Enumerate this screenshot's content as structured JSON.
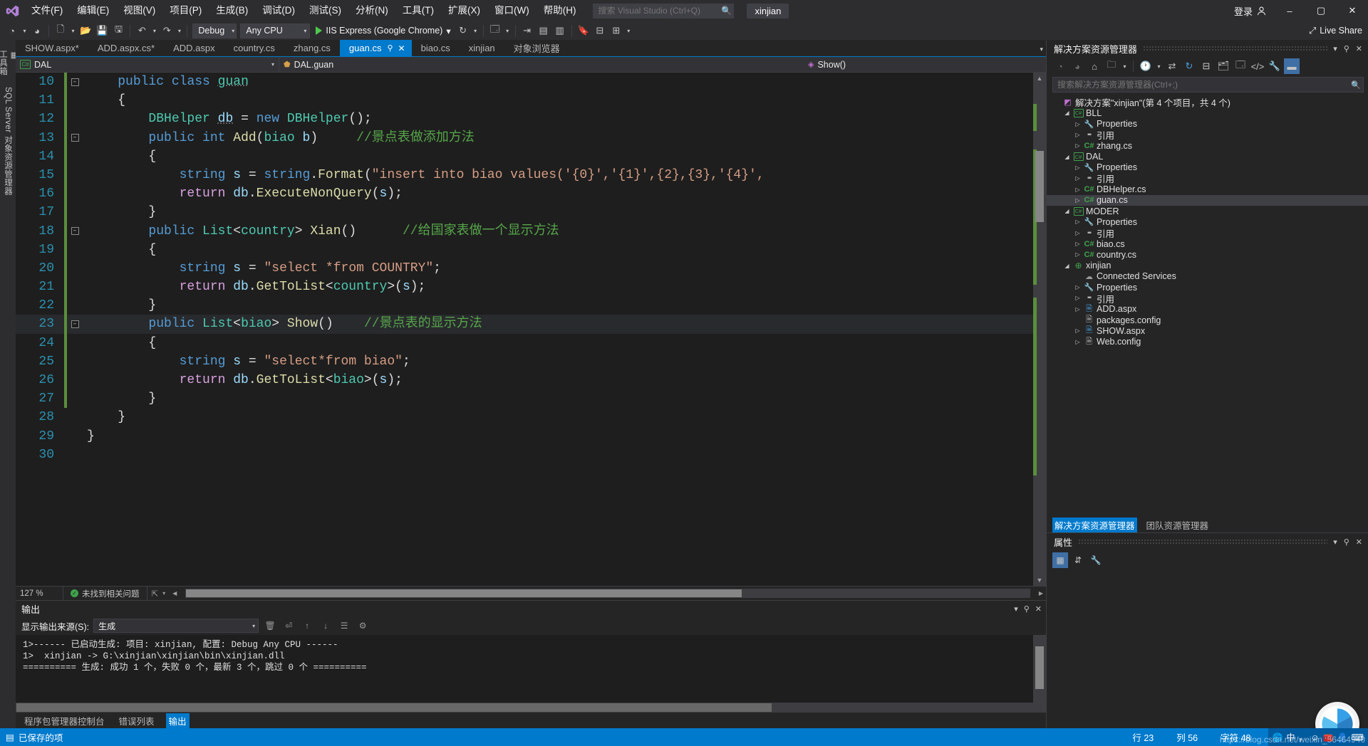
{
  "window": {
    "title": "xinjian",
    "signin_label": "登录",
    "minimize": "–",
    "maximize": "▢",
    "close": "✕"
  },
  "menu": {
    "items": [
      {
        "label": "文件(F)",
        "name": "menu-file"
      },
      {
        "label": "编辑(E)",
        "name": "menu-edit"
      },
      {
        "label": "视图(V)",
        "name": "menu-view"
      },
      {
        "label": "项目(P)",
        "name": "menu-project"
      },
      {
        "label": "生成(B)",
        "name": "menu-build"
      },
      {
        "label": "调试(D)",
        "name": "menu-debug"
      },
      {
        "label": "测试(S)",
        "name": "menu-test"
      },
      {
        "label": "分析(N)",
        "name": "menu-analyze"
      },
      {
        "label": "工具(T)",
        "name": "menu-tools"
      },
      {
        "label": "扩展(X)",
        "name": "menu-extensions"
      },
      {
        "label": "窗口(W)",
        "name": "menu-window"
      },
      {
        "label": "帮助(H)",
        "name": "menu-help"
      }
    ]
  },
  "quick_search": {
    "placeholder": "搜索 Visual Studio (Ctrl+Q)",
    "value": ""
  },
  "toolbar": {
    "config_value": "Debug",
    "platform_value": "Any CPU",
    "run_label": "IIS Express (Google Chrome)",
    "live_share": "Live Share"
  },
  "editor_tabs": [
    {
      "label": "SHOW.aspx*",
      "active": false
    },
    {
      "label": "ADD.aspx.cs*",
      "active": false
    },
    {
      "label": "ADD.aspx",
      "active": false
    },
    {
      "label": "country.cs",
      "active": false
    },
    {
      "label": "zhang.cs",
      "active": false
    },
    {
      "label": "guan.cs",
      "active": true
    },
    {
      "label": "biao.cs",
      "active": false
    },
    {
      "label": "xinjian",
      "active": false
    },
    {
      "label": "对象浏览器",
      "active": false
    }
  ],
  "nav_bar": {
    "namespace": "DAL",
    "type": "DAL.guan",
    "member": "Show()"
  },
  "left_rail": [
    {
      "label": "工具箱",
      "name": "toolbox"
    },
    {
      "label": "SQL Server 对象资源管理器",
      "name": "sql-server-object-explorer"
    }
  ],
  "code": {
    "zoom": "127 %",
    "issues": "未找到相关问题",
    "lines": [
      {
        "n": "10",
        "fold": "minus",
        "change": true,
        "html": "<span class=\"kw\">public</span> <span class=\"kw\">class</span> <span class=\"typ udl\">guan</span>",
        "indent": 2
      },
      {
        "n": "11",
        "fold": "",
        "change": true,
        "html": "<span class=\"brc\">{</span>",
        "indent": 2
      },
      {
        "n": "12",
        "fold": "",
        "change": true,
        "html": "<span class=\"typ\">DBHelper</span> <span class=\"var udl\">db</span> <span class=\"pun\">=</span> <span class=\"kw\">new</span> <span class=\"typ\">DBHelper</span><span class=\"pun\">();</span>",
        "indent": 3
      },
      {
        "n": "13",
        "fold": "minus",
        "change": true,
        "html": "<span class=\"kw\">public</span> <span class=\"kw\">int</span> <span class=\"mth\">Add</span><span class=\"pun\">(</span><span class=\"typ\">biao</span> <span class=\"var\">b</span><span class=\"pun\">)</span>     <span class=\"cmt\">//景点表做添加方法</span>",
        "indent": 3
      },
      {
        "n": "14",
        "fold": "",
        "change": true,
        "html": "<span class=\"brc\">{</span>",
        "indent": 3
      },
      {
        "n": "15",
        "fold": "",
        "change": true,
        "html": "<span class=\"kw\">string</span> <span class=\"var\">s</span> <span class=\"pun\">=</span> <span class=\"kw\">string</span><span class=\"pun\">.</span><span class=\"mth\">Format</span><span class=\"pun\">(</span><span class=\"str\">\"insert into biao values('{0}','{1}',{2},{3},'{4}',</span>",
        "indent": 4
      },
      {
        "n": "16",
        "fold": "",
        "change": true,
        "html": "<span class=\"ctl\">return</span> <span class=\"var\">db</span><span class=\"pun\">.</span><span class=\"mth\">ExecuteNonQuery</span><span class=\"pun\">(</span><span class=\"var\">s</span><span class=\"pun\">);</span>",
        "indent": 4
      },
      {
        "n": "17",
        "fold": "",
        "change": true,
        "html": "<span class=\"brc\">}</span>",
        "indent": 3
      },
      {
        "n": "18",
        "fold": "minus",
        "change": true,
        "html": "<span class=\"kw\">public</span> <span class=\"typ\">List</span><span class=\"pun\">&lt;</span><span class=\"typ\">country</span><span class=\"pun\">&gt;</span> <span class=\"mth\">Xian</span><span class=\"pun\">()</span>      <span class=\"cmt\">//给国家表做一个显示方法</span>",
        "indent": 3
      },
      {
        "n": "19",
        "fold": "",
        "change": true,
        "html": "<span class=\"brc\">{</span>",
        "indent": 3
      },
      {
        "n": "20",
        "fold": "",
        "change": true,
        "html": "<span class=\"kw\">string</span> <span class=\"var\">s</span> <span class=\"pun\">=</span> <span class=\"str\">\"select *from COUNTRY\"</span><span class=\"pun\">;</span>",
        "indent": 4
      },
      {
        "n": "21",
        "fold": "",
        "change": true,
        "html": "<span class=\"ctl\">return</span> <span class=\"var\">db</span><span class=\"pun\">.</span><span class=\"mth\">GetToList</span><span class=\"pun\">&lt;</span><span class=\"typ\">country</span><span class=\"pun\">&gt;(</span><span class=\"var\">s</span><span class=\"pun\">);</span>",
        "indent": 4
      },
      {
        "n": "22",
        "fold": "",
        "change": true,
        "html": "<span class=\"brc\">}</span>",
        "indent": 3
      },
      {
        "n": "23",
        "fold": "minus",
        "change": true,
        "html": "<span class=\"kw\">public</span> <span class=\"typ\">List</span><span class=\"pun\">&lt;</span><span class=\"typ\">biao</span><span class=\"pun\">&gt;</span> <span class=\"mth\">Show</span><span class=\"pun\">()</span>    <span class=\"cmt\">//景点表的显示方法</span>",
        "indent": 3,
        "highlight": true
      },
      {
        "n": "24",
        "fold": "",
        "change": true,
        "html": "<span class=\"brc\">{</span>",
        "indent": 3
      },
      {
        "n": "25",
        "fold": "",
        "change": true,
        "html": "<span class=\"kw\">string</span> <span class=\"var\">s</span> <span class=\"pun\">=</span> <span class=\"str\">\"select*from biao\"</span><span class=\"pun\">;</span>",
        "indent": 4
      },
      {
        "n": "26",
        "fold": "",
        "change": true,
        "html": "<span class=\"ctl\">return</span> <span class=\"var\">db</span><span class=\"pun\">.</span><span class=\"mth\">GetToList</span><span class=\"pun\">&lt;</span><span class=\"typ\">biao</span><span class=\"pun\">&gt;(</span><span class=\"var\">s</span><span class=\"pun\">);</span>",
        "indent": 4
      },
      {
        "n": "27",
        "fold": "",
        "change": true,
        "html": "<span class=\"brc\">}</span>",
        "indent": 3
      },
      {
        "n": "28",
        "fold": "",
        "change": false,
        "html": "<span class=\"brc\">}</span>",
        "indent": 2
      },
      {
        "n": "29",
        "fold": "",
        "change": false,
        "html": "<span class=\"brc\">}</span>",
        "indent": 1
      },
      {
        "n": "30",
        "fold": "",
        "change": false,
        "html": "",
        "indent": 0
      }
    ]
  },
  "output": {
    "title": "输出",
    "source_label": "显示输出来源(S):",
    "source_value": "生成",
    "lines": [
      "1>------ 已启动生成: 项目: xinjian, 配置: Debug Any CPU ------",
      "1>  xinjian -> G:\\xinjian\\xinjian\\bin\\xinjian.dll",
      "========== 生成: 成功 1 个，失败 0 个，最新 3 个，跳过 0 个 =========="
    ],
    "tabs": [
      {
        "label": "程序包管理器控制台",
        "active": false
      },
      {
        "label": "错误列表",
        "active": false
      },
      {
        "label": "输出",
        "active": true
      }
    ]
  },
  "solution_explorer": {
    "title": "解决方案资源管理器",
    "search_placeholder": "搜索解决方案资源管理器(Ctrl+;)",
    "tabs": [
      {
        "label": "解决方案资源管理器",
        "active": true
      },
      {
        "label": "团队资源管理器",
        "active": false
      }
    ],
    "tree": [
      {
        "depth": 0,
        "arrow": "",
        "icon": "sln",
        "label": "解决方案\"xinjian\"(第 4 个项目，共 4 个)",
        "selected": false
      },
      {
        "depth": 1,
        "arrow": "open",
        "icon": "csproj",
        "label": "BLL",
        "selected": false
      },
      {
        "depth": 2,
        "arrow": "closed",
        "icon": "wrench",
        "label": "Properties",
        "selected": false
      },
      {
        "depth": 2,
        "arrow": "closed",
        "icon": "ref",
        "label": "引用",
        "selected": false
      },
      {
        "depth": 2,
        "arrow": "closed",
        "icon": "csfile",
        "label": "zhang.cs",
        "selected": false
      },
      {
        "depth": 1,
        "arrow": "open",
        "icon": "csproj",
        "label": "DAL",
        "selected": false
      },
      {
        "depth": 2,
        "arrow": "closed",
        "icon": "wrench",
        "label": "Properties",
        "selected": false
      },
      {
        "depth": 2,
        "arrow": "closed",
        "icon": "ref",
        "label": "引用",
        "selected": false
      },
      {
        "depth": 2,
        "arrow": "closed",
        "icon": "csfile",
        "label": "DBHelper.cs",
        "selected": false
      },
      {
        "depth": 2,
        "arrow": "closed",
        "icon": "csfile",
        "label": "guan.cs",
        "selected": true
      },
      {
        "depth": 1,
        "arrow": "open",
        "icon": "csproj",
        "label": "MODER",
        "selected": false
      },
      {
        "depth": 2,
        "arrow": "closed",
        "icon": "wrench",
        "label": "Properties",
        "selected": false
      },
      {
        "depth": 2,
        "arrow": "closed",
        "icon": "ref",
        "label": "引用",
        "selected": false
      },
      {
        "depth": 2,
        "arrow": "closed",
        "icon": "csfile",
        "label": "biao.cs",
        "selected": false
      },
      {
        "depth": 2,
        "arrow": "closed",
        "icon": "csfile",
        "label": "country.cs",
        "selected": false
      },
      {
        "depth": 1,
        "arrow": "open",
        "icon": "web",
        "label": "xinjian",
        "selected": false
      },
      {
        "depth": 2,
        "arrow": "",
        "icon": "cloud",
        "label": "Connected Services",
        "selected": false
      },
      {
        "depth": 2,
        "arrow": "closed",
        "icon": "wrench",
        "label": "Properties",
        "selected": false
      },
      {
        "depth": 2,
        "arrow": "closed",
        "icon": "ref",
        "label": "引用",
        "selected": false
      },
      {
        "depth": 2,
        "arrow": "closed",
        "icon": "aspx",
        "label": "ADD.aspx",
        "selected": false
      },
      {
        "depth": 2,
        "arrow": "",
        "icon": "cfg",
        "label": "packages.config",
        "selected": false
      },
      {
        "depth": 2,
        "arrow": "closed",
        "icon": "aspx",
        "label": "SHOW.aspx",
        "selected": false
      },
      {
        "depth": 2,
        "arrow": "closed",
        "icon": "cfg",
        "label": "Web.config",
        "selected": false
      }
    ]
  },
  "properties": {
    "title": "属性"
  },
  "status_bar": {
    "saved": "已保存的项",
    "line_label": "行 23",
    "col_label": "列 56",
    "char_label": "字符 48",
    "ime_mode": "中",
    "watermark": "https://blog.csdn.net/weixin_56464940"
  },
  "colors": {
    "accent": "#007acc",
    "titlebar": "#2d2d30",
    "panel": "#252526",
    "editor_bg": "#1e1e1e",
    "keyword": "#569cd6",
    "type": "#4ec9b0",
    "string": "#d69d85",
    "comment": "#57a64a",
    "method": "#dcdcaa",
    "linenum": "#2b91af"
  }
}
